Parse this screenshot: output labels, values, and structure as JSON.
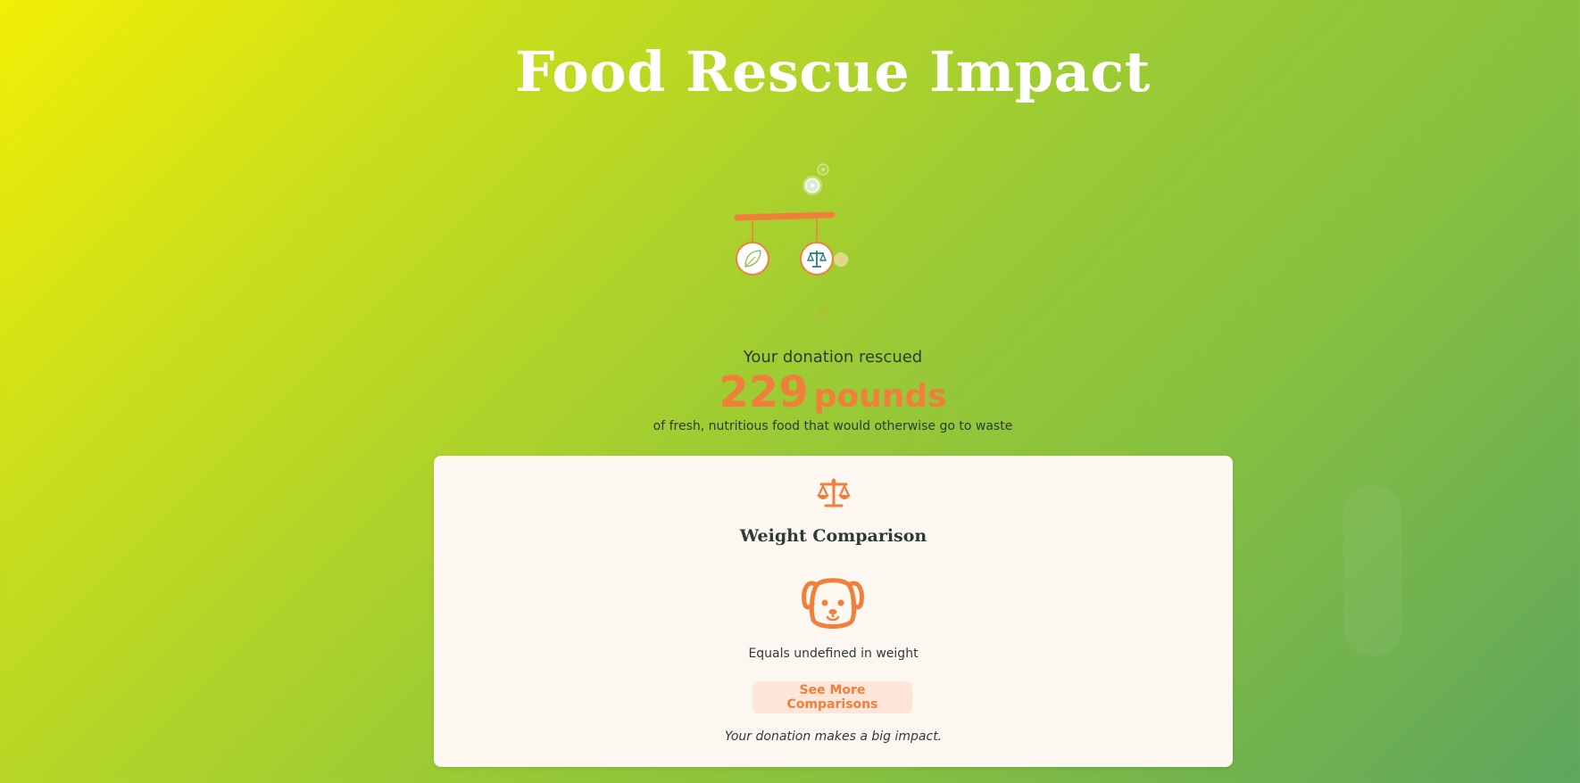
{
  "header": {
    "title": "Food Rescue Impact"
  },
  "mobile_icons": [
    "leaf-icon",
    "scale-icon"
  ],
  "impact": {
    "label": "Your donation rescued",
    "amount": "229",
    "unit": "pounds",
    "description": "of fresh, nutritious food that would otherwise go to waste"
  },
  "card": {
    "icon": "scale-icon",
    "title": "Weight Comparison",
    "comparison_icon": "dog-icon",
    "comparison_text": "Equals undefined in weight",
    "button_label": "See More Comparisons",
    "note": "Your donation makes a big impact."
  },
  "colors": {
    "accent": "#f07f3c",
    "card_bg": "#fdf7f2",
    "button_bg": "#fde6d9",
    "teal": "#2a7d80",
    "text": "#2e3b33"
  }
}
